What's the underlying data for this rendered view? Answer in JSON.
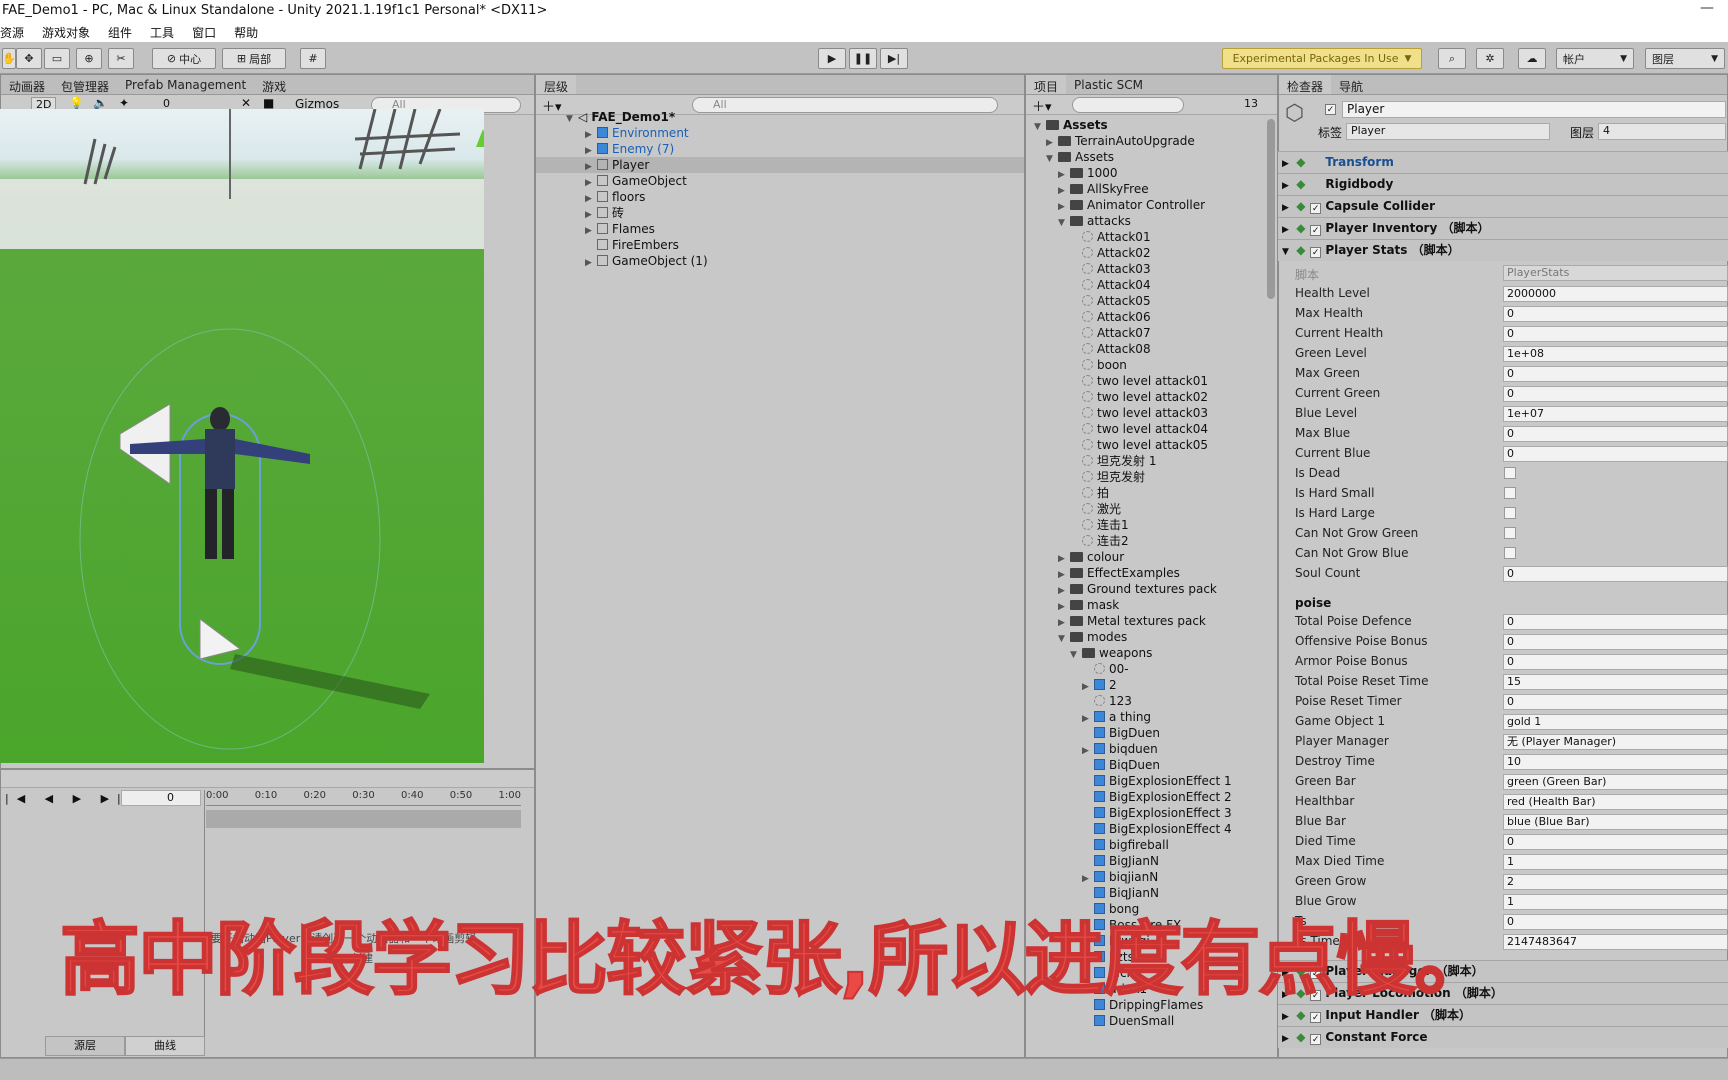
{
  "titlebar": {
    "title": "FAE_Demo1 - PC, Mac & Linux Standalone - Unity 2021.1.19f1c1 Personal* <DX11>"
  },
  "menu": [
    "资源",
    "游戏对象",
    "组件",
    "工具",
    "窗口",
    "帮助"
  ],
  "toolbar": {
    "center_label": "中心",
    "local_label": "局部",
    "experimental": "Experimental Packages In Use",
    "account": "帐户",
    "layers": "图层"
  },
  "scene_panel": {
    "tabs": [
      "动画器",
      "包管理器",
      "Prefab Management",
      "游戏"
    ],
    "mode_2d": "2D",
    "fx_count": "0",
    "gizmos": "Gizmos",
    "search_placeholder": "All"
  },
  "anim_panel": {
    "frame": "0",
    "times": [
      "0:00",
      "0:10",
      "0:20",
      "0:30",
      "0:40",
      "0:50",
      "1:00"
    ],
    "message": "要开始动画Player，请创建一个动画器和一个动画剪辑。",
    "create": "创建",
    "tabs": [
      "源层",
      "曲线"
    ]
  },
  "hierarchy": {
    "tab": "层级",
    "search_placeholder": "All",
    "scene": "FAE_Demo1*",
    "items": [
      {
        "label": "Environment",
        "kind": "blue",
        "arrow": true,
        "color": "#1a5fb4"
      },
      {
        "label": "Enemy (7)",
        "kind": "blue",
        "arrow": true,
        "color": "#1a5fb4"
      },
      {
        "label": "Player",
        "kind": "cube",
        "arrow": true,
        "color": "#111111"
      },
      {
        "label": "GameObject",
        "kind": "cube",
        "arrow": true,
        "color": "#111111"
      },
      {
        "label": "floors",
        "kind": "cube",
        "arrow": true,
        "color": "#111111"
      },
      {
        "label": "砖",
        "kind": "cube",
        "arrow": true,
        "color": "#111111"
      },
      {
        "label": "Flames",
        "kind": "cube",
        "arrow": true,
        "color": "#111111"
      },
      {
        "label": "FireEmbers",
        "kind": "cube",
        "arrow": false,
        "color": "#111111"
      },
      {
        "label": "GameObject (1)",
        "kind": "cube",
        "arrow": true,
        "color": "#111111"
      }
    ]
  },
  "project": {
    "tabs": [
      "项目",
      "Plastic SCM"
    ],
    "count": "13",
    "items": [
      {
        "label": "Assets",
        "depth": 0,
        "type": "folder",
        "arrow": "▼",
        "bold": true
      },
      {
        "label": "TerrainAutoUpgrade",
        "depth": 1,
        "type": "folder",
        "arrow": "▶"
      },
      {
        "label": "Assets",
        "depth": 1,
        "type": "folder",
        "arrow": "▼"
      },
      {
        "label": "1000",
        "depth": 2,
        "type": "folder",
        "arrow": "▶"
      },
      {
        "label": "AllSkyFree",
        "depth": 2,
        "type": "folder",
        "arrow": "▶"
      },
      {
        "label": "Animator Controller",
        "depth": 2,
        "type": "folder",
        "arrow": "▶"
      },
      {
        "label": "attacks",
        "depth": 2,
        "type": "folder",
        "arrow": "▼"
      },
      {
        "label": "Attack01",
        "depth": 3,
        "type": "anim",
        "arrow": ""
      },
      {
        "label": "Attack02",
        "depth": 3,
        "type": "anim",
        "arrow": ""
      },
      {
        "label": "Attack03",
        "depth": 3,
        "type": "anim",
        "arrow": ""
      },
      {
        "label": "Attack04",
        "depth": 3,
        "type": "anim",
        "arrow": ""
      },
      {
        "label": "Attack05",
        "depth": 3,
        "type": "anim",
        "arrow": ""
      },
      {
        "label": "Attack06",
        "depth": 3,
        "type": "anim",
        "arrow": ""
      },
      {
        "label": "Attack07",
        "depth": 3,
        "type": "anim",
        "arrow": ""
      },
      {
        "label": "Attack08",
        "depth": 3,
        "type": "anim",
        "arrow": ""
      },
      {
        "label": "boon",
        "depth": 3,
        "type": "anim",
        "arrow": ""
      },
      {
        "label": "two level attack01",
        "depth": 3,
        "type": "anim",
        "arrow": ""
      },
      {
        "label": "two level attack02",
        "depth": 3,
        "type": "anim",
        "arrow": ""
      },
      {
        "label": "two level attack03",
        "depth": 3,
        "type": "anim",
        "arrow": ""
      },
      {
        "label": "two level attack04",
        "depth": 3,
        "type": "anim",
        "arrow": ""
      },
      {
        "label": "two level attack05",
        "depth": 3,
        "type": "anim",
        "arrow": ""
      },
      {
        "label": "坦克发射 1",
        "depth": 3,
        "type": "anim",
        "arrow": ""
      },
      {
        "label": "坦克发射",
        "depth": 3,
        "type": "anim",
        "arrow": ""
      },
      {
        "label": "拍",
        "depth": 3,
        "type": "anim",
        "arrow": ""
      },
      {
        "label": "激光",
        "depth": 3,
        "type": "anim",
        "arrow": ""
      },
      {
        "label": "连击1",
        "depth": 3,
        "type": "anim",
        "arrow": ""
      },
      {
        "label": "连击2",
        "depth": 3,
        "type": "anim",
        "arrow": ""
      },
      {
        "label": "colour",
        "depth": 2,
        "type": "folder",
        "arrow": "▶"
      },
      {
        "label": "EffectExamples",
        "depth": 2,
        "type": "folder",
        "arrow": "▶"
      },
      {
        "label": "Ground textures pack",
        "depth": 2,
        "type": "folder",
        "arrow": "▶"
      },
      {
        "label": "mask",
        "depth": 2,
        "type": "folder",
        "arrow": "▶"
      },
      {
        "label": "Metal textures pack",
        "depth": 2,
        "type": "folder",
        "arrow": "▶"
      },
      {
        "label": "modes",
        "depth": 2,
        "type": "folder",
        "arrow": "▼"
      },
      {
        "label": "weapons",
        "depth": 3,
        "type": "folder",
        "arrow": "▼"
      },
      {
        "label": "00-",
        "depth": 4,
        "type": "anim",
        "arrow": ""
      },
      {
        "label": "2",
        "depth": 4,
        "type": "blue",
        "arrow": "▶"
      },
      {
        "label": "123",
        "depth": 4,
        "type": "anim",
        "arrow": ""
      },
      {
        "label": "a thing",
        "depth": 4,
        "type": "blue",
        "arrow": "▶"
      },
      {
        "label": "BigDuen",
        "depth": 4,
        "type": "blue",
        "arrow": ""
      },
      {
        "label": "biqduen",
        "depth": 4,
        "type": "blue",
        "arrow": "▶"
      },
      {
        "label": "BiqDuen",
        "depth": 4,
        "type": "blue",
        "arrow": ""
      },
      {
        "label": "BigExplosionEffect 1",
        "depth": 4,
        "type": "blue",
        "arrow": ""
      },
      {
        "label": "BigExplosionEffect 2",
        "depth": 4,
        "type": "blue",
        "arrow": ""
      },
      {
        "label": "BigExplosionEffect 3",
        "depth": 4,
        "type": "blue",
        "arrow": ""
      },
      {
        "label": "BigExplosionEffect 4",
        "depth": 4,
        "type": "blue",
        "arrow": ""
      },
      {
        "label": "bigfireball",
        "depth": 4,
        "type": "blue",
        "arrow": ""
      },
      {
        "label": "BigJianN",
        "depth": 4,
        "type": "blue",
        "arrow": ""
      },
      {
        "label": "biqjianN",
        "depth": 4,
        "type": "blue",
        "arrow": "▶"
      },
      {
        "label": "BiqJianN",
        "depth": 4,
        "type": "blue",
        "arrow": ""
      },
      {
        "label": "bong",
        "depth": 4,
        "type": "blue",
        "arrow": ""
      },
      {
        "label": "Boss Fire FX",
        "depth": 4,
        "type": "blue",
        "arrow": ""
      },
      {
        "label": "btwuqi",
        "depth": 4,
        "type": "blue",
        "arrow": ""
      },
      {
        "label": "bzts",
        "depth": 4,
        "type": "blue",
        "arrow": ""
      },
      {
        "label": "dici",
        "depth": 4,
        "type": "blue",
        "arrow": ""
      },
      {
        "label": "drink1",
        "depth": 4,
        "type": "blue",
        "arrow": ""
      },
      {
        "label": "DrippingFlames",
        "depth": 4,
        "type": "blue",
        "arrow": ""
      },
      {
        "label": "DuenSmall",
        "depth": 4,
        "type": "blue",
        "arrow": ""
      }
    ]
  },
  "inspector": {
    "tabs": [
      "检查器",
      "导航"
    ],
    "object_name": "Player",
    "tag_label": "标签",
    "tag_value": "Player",
    "layer_label": "图层",
    "layer_value": "4",
    "components_top": [
      {
        "label": "Transform",
        "checkbox": false,
        "color": "#1a4f8f"
      },
      {
        "label": "Rigidbody",
        "checkbox": false,
        "color": "#111111"
      },
      {
        "label": "Capsule Collider",
        "checkbox": true,
        "color": "#111111"
      },
      {
        "label": "Player Inventory （脚本）",
        "checkbox": true,
        "color": "#111111"
      },
      {
        "label": "Player Stats （脚本）",
        "checkbox": true,
        "color": "#111111"
      }
    ],
    "script_label": "脚本",
    "script_value": "PlayerStats",
    "fields": [
      {
        "label": "Health Level",
        "value": "2000000"
      },
      {
        "label": "Max Health",
        "value": "0"
      },
      {
        "label": "Current Health",
        "value": "0"
      },
      {
        "label": "Green Level",
        "value": "1e+08"
      },
      {
        "label": "Max Green",
        "value": "0"
      },
      {
        "label": "Current Green",
        "value": "0"
      },
      {
        "label": "Blue Level",
        "value": "1e+07"
      },
      {
        "label": "Max Blue",
        "value": "0"
      },
      {
        "label": "Current Blue",
        "value": "0"
      },
      {
        "label": "Is Dead",
        "value": "",
        "checkbox": true
      },
      {
        "label": "Is Hard Small",
        "value": "",
        "checkbox": true
      },
      {
        "label": "Is Hard Large",
        "value": "",
        "checkbox": true
      },
      {
        "label": "Can Not Grow Green",
        "value": "",
        "checkbox": true
      },
      {
        "label": "Can Not Grow Blue",
        "value": "",
        "checkbox": true
      },
      {
        "label": "Soul Count",
        "value": "0"
      }
    ],
    "section": "poise",
    "fields2": [
      {
        "label": "Total Poise Defence",
        "value": "0"
      },
      {
        "label": "Offensive Poise Bonus",
        "value": "0"
      },
      {
        "label": "Armor Poise Bonus",
        "value": "0"
      },
      {
        "label": "Total Poise Reset Time",
        "value": "15"
      },
      {
        "label": "Poise Reset Timer",
        "value": "0"
      },
      {
        "label": "Game Object 1",
        "value": "gold 1"
      },
      {
        "label": "Player Manager",
        "value": "无 (Player Manager)"
      },
      {
        "label": "Destroy Time",
        "value": "10"
      },
      {
        "label": "Green Bar",
        "value": "green (Green Bar)"
      },
      {
        "label": "Healthbar",
        "value": "red (Health Bar)"
      },
      {
        "label": "Blue Bar",
        "value": "blue (Blue Bar)"
      },
      {
        "label": "Died Time",
        "value": "0"
      },
      {
        "label": "Max Died Time",
        "value": "1"
      },
      {
        "label": "Green Grow",
        "value": "2"
      },
      {
        "label": "Blue Grow",
        "value": "1"
      },
      {
        "label": "Ts",
        "value": "0"
      },
      {
        "label": "Ts Time",
        "value": "2147483647"
      }
    ],
    "components_bottom": [
      {
        "label": "Player Manager （脚本）"
      },
      {
        "label": "Player Locomotion （脚本）"
      },
      {
        "label": "Input Handler （脚本）"
      },
      {
        "label": "Constant Force"
      }
    ]
  },
  "overlay": {
    "text": "高中阶段学习比较紧张,所以进度有点慢。"
  }
}
